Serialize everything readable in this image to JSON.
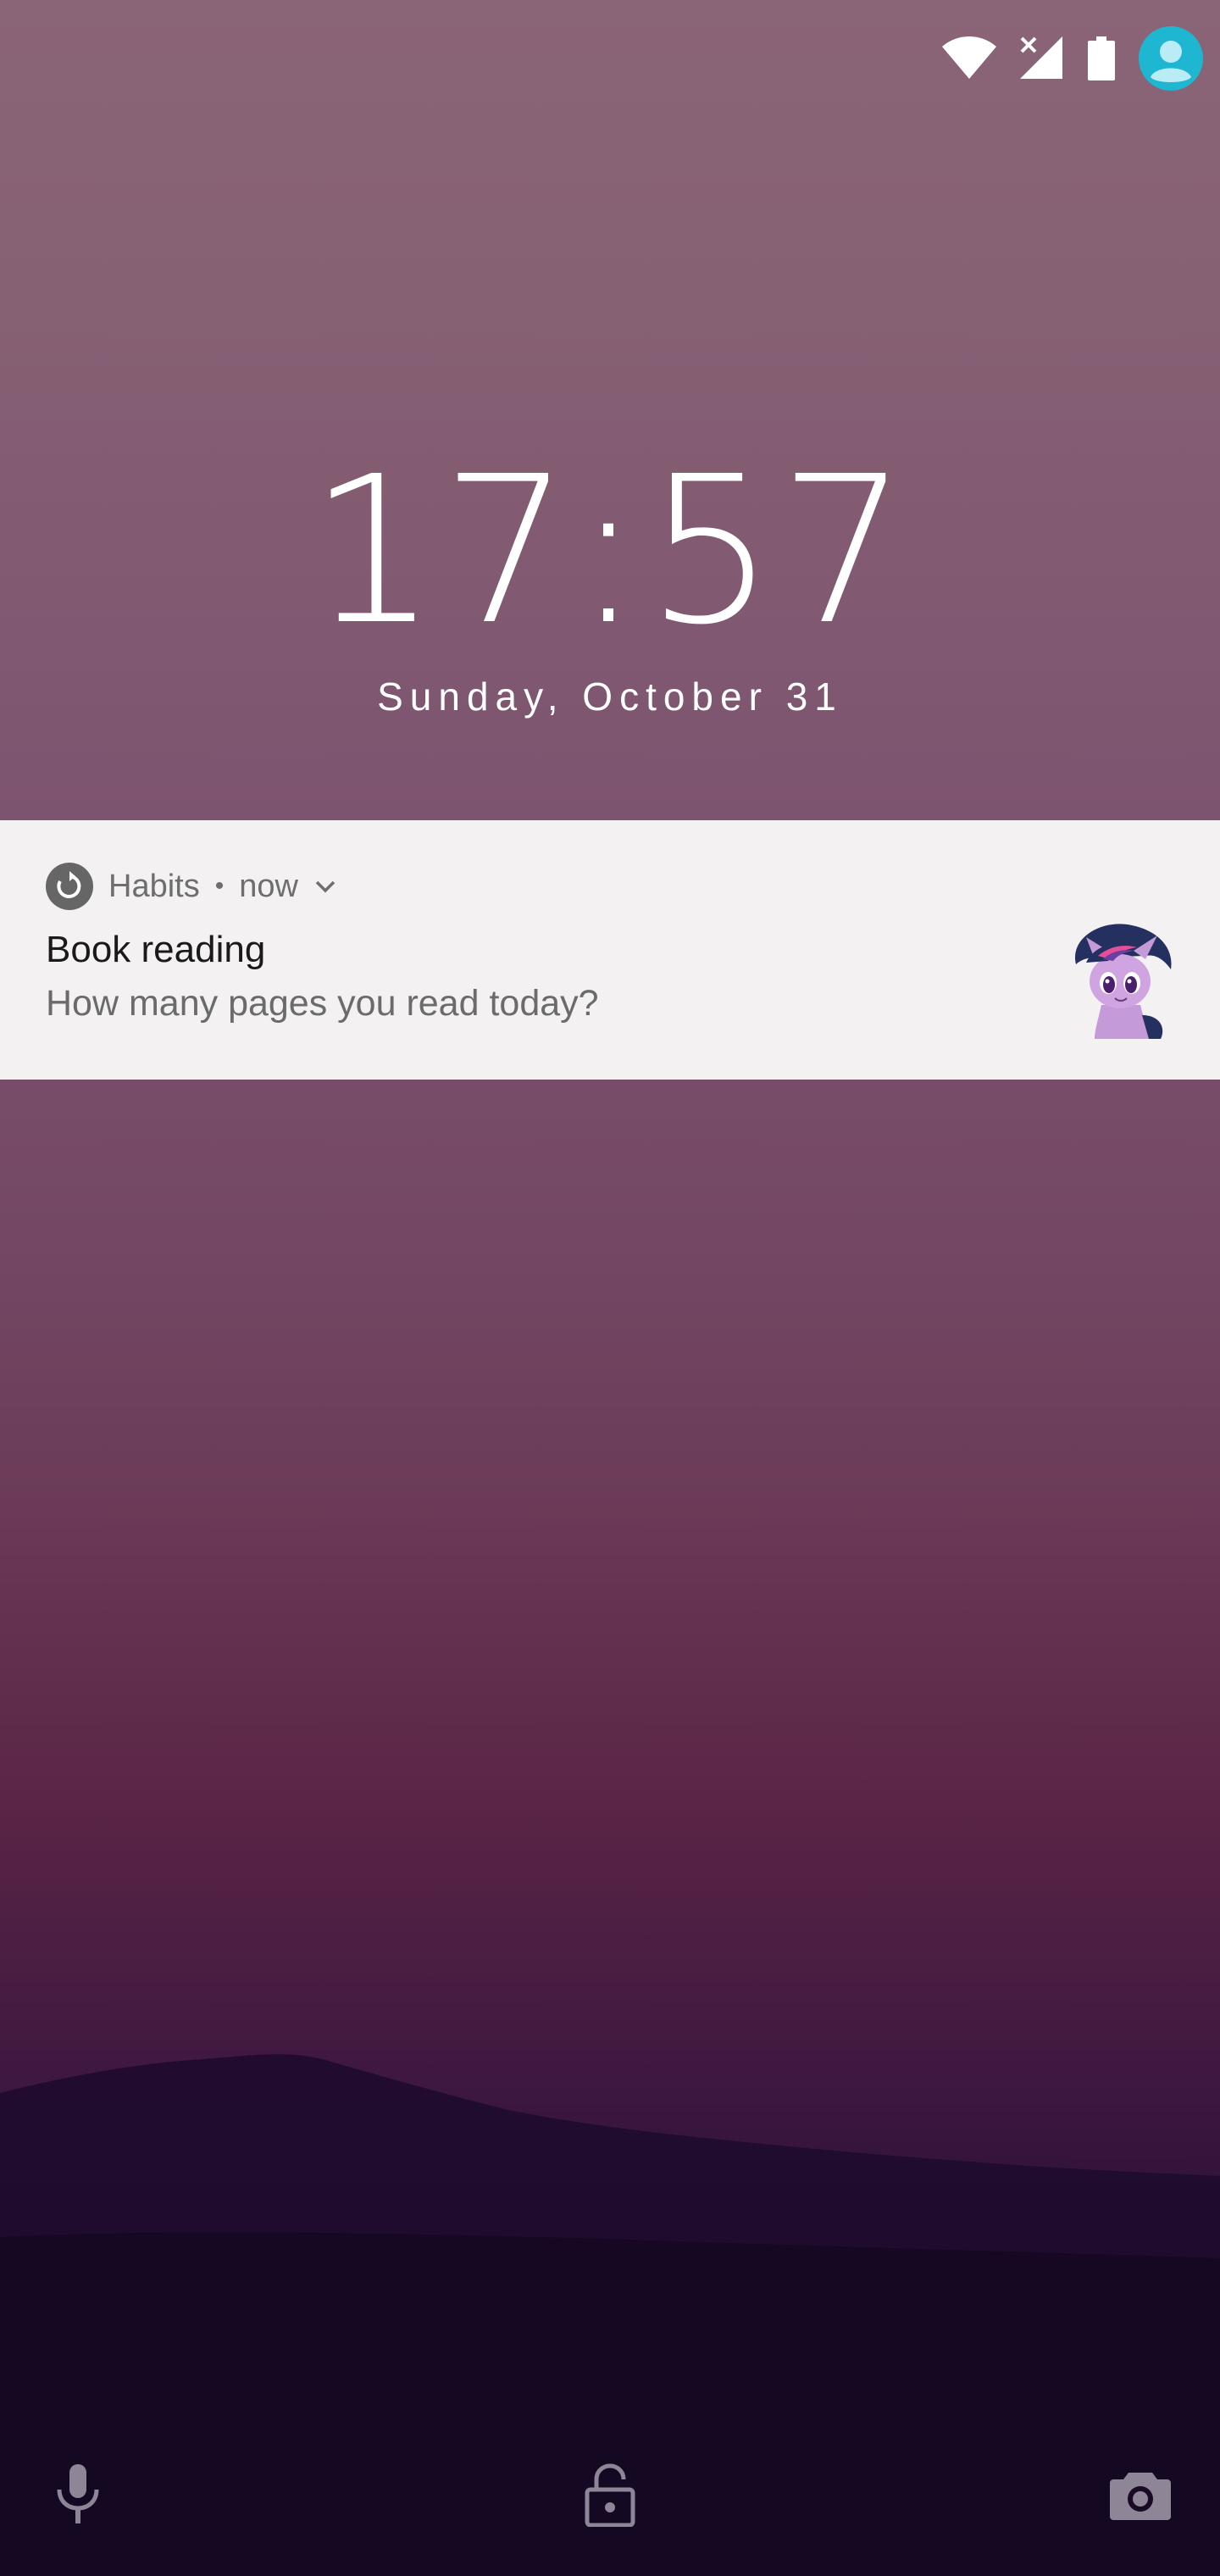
{
  "status_bar": {
    "icons": [
      "wifi-icon",
      "cellular-no-signal-icon",
      "battery-icon",
      "user-avatar-icon"
    ],
    "accent_color": "#1fb6d1"
  },
  "lockscreen": {
    "time": "17:57",
    "date": "Sunday, October 31"
  },
  "notification": {
    "app_name": "Habits",
    "separator": "•",
    "time": "now",
    "title": "Book reading",
    "text": "How many pages you read today?",
    "app_icon": "habits-refresh-icon",
    "expand_icon": "chevron-down-icon",
    "thumbnail": "pony-character-image"
  },
  "bottom_bar": {
    "icons": [
      "microphone-icon",
      "unlock-icon",
      "camera-icon"
    ]
  },
  "colors": {
    "card_bg": "#f3f1f2",
    "clock_text": "#ffffff"
  }
}
